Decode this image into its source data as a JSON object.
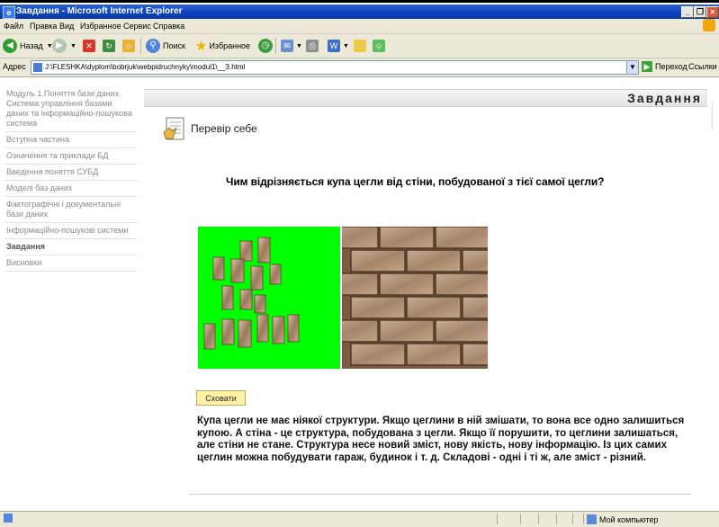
{
  "window": {
    "title": "Завдання - Microsoft Internet Explorer"
  },
  "menu": [
    "Файл",
    "Правка",
    "Вид",
    "Избранное",
    "Сервис",
    "Справка"
  ],
  "toolbar": {
    "back_label": "Назад",
    "search_label": "Поиск",
    "favorites_label": "Избранное"
  },
  "address": {
    "label": "Адрес",
    "value": "J:\\FLESHKA\\dyplom\\bobrjuk\\webpidruchnyky\\modul1\\__3.html",
    "go_label": "Переход",
    "links_label": "Ссылки"
  },
  "sidebar": {
    "items": [
      {
        "label": "Модуль 1.Поняття бази даних. Система управління базами даних та інформаційно-пошукова система",
        "active": false
      },
      {
        "label": "Вступна частина",
        "active": false
      },
      {
        "label": "Означення та приклади БД",
        "active": false
      },
      {
        "label": "Введення поняття СУБД",
        "active": false
      },
      {
        "label": "Моделі баз даних",
        "active": false
      },
      {
        "label": "Фактографічні і документальні бази даних",
        "active": false
      },
      {
        "label": "Інформаційно-пошукові системи",
        "active": false
      },
      {
        "label": "Завдання",
        "active": true
      },
      {
        "label": "Висновки",
        "active": false
      }
    ]
  },
  "page": {
    "title": "Завдання",
    "section_title": "Перевір себе",
    "question": "Чим відрізняється купа цегли від стіни, побудованої з тієї самої цегли?",
    "hide_button": "Сховати",
    "answer": "Купа цегли не має ніякої структури. Якщо цеглини в ній змішати, то вона все одно залишиться купою. А стіна - це структура, побудована з цегли. Якщо її порушити, то цеглини залишаться, але стіни не стане. Структура несе новий зміст, нову якість, нову інформацію. Із цих самих цеглин можна побудувати гараж, будинок і т. д. Складові - одні і ті ж, але зміст - різний."
  },
  "status": {
    "zone": "Мой компьютер"
  },
  "colors": {
    "titlebar": "#0a3fb8",
    "pile_background": "#00ff00",
    "hide_button_bg": "#fff2a6"
  }
}
